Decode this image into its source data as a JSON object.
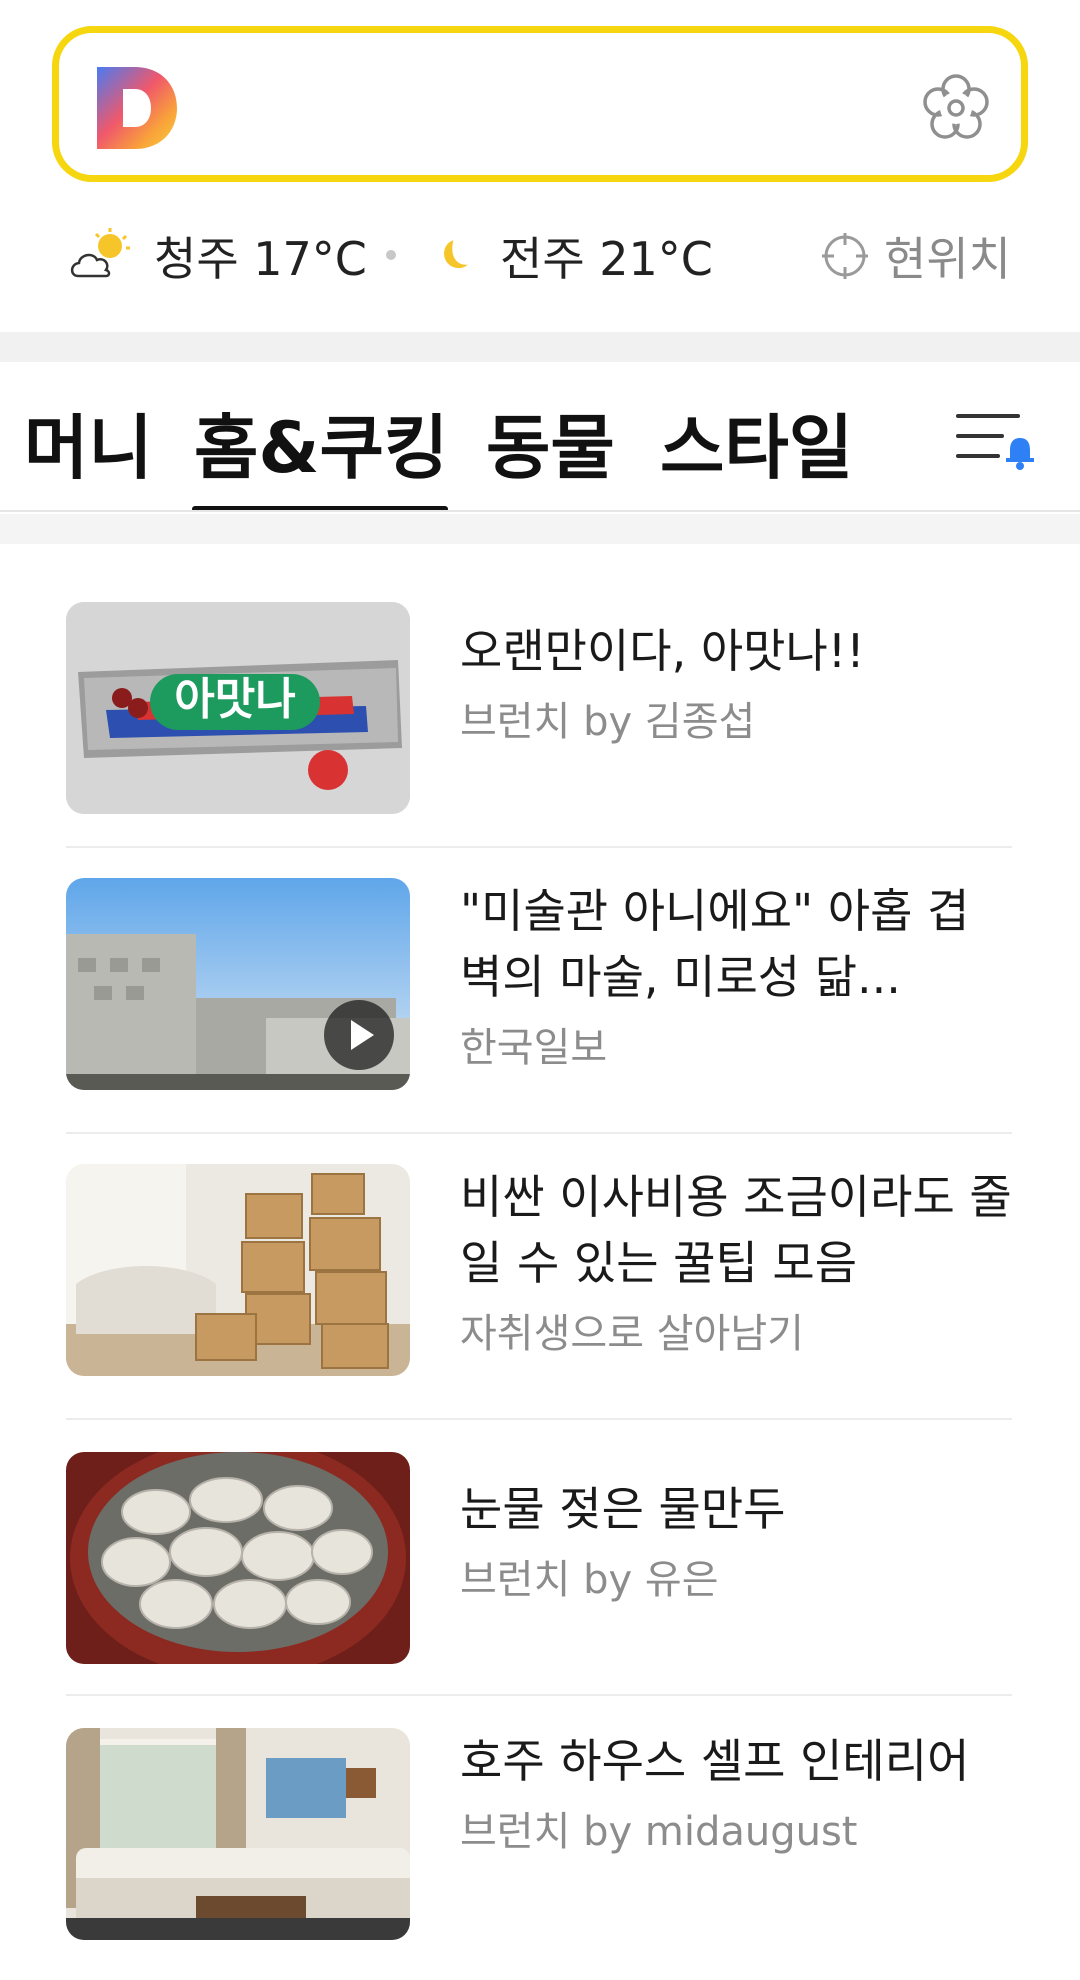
{
  "search": {
    "logo": "daum-logo",
    "right_icon": "flower-icon",
    "border_color": "#f5d60f"
  },
  "weather": {
    "items": [
      {
        "icon": "sun-cloud-icon",
        "label": "청주 17°C"
      },
      {
        "icon": "moon-icon",
        "label": "전주 21°C"
      }
    ],
    "location": {
      "icon": "crosshair-icon",
      "label": "현위치"
    }
  },
  "tabs": {
    "items": [
      {
        "label": "머니"
      },
      {
        "label": "홈&쿠킹",
        "active": true
      },
      {
        "label": "동물"
      },
      {
        "label": "스타일"
      },
      {
        "label": ""
      }
    ],
    "menu_icon": "menu-notification-icon"
  },
  "articles": [
    {
      "title": "오랜만이다, 아맛나!!",
      "source": "브런치 by 김종섭",
      "thumb": "ice-cream-wrapper"
    },
    {
      "title": "\"미술관 아니에요\" 아홉 겹 벽의 마술, 미로성 닮...",
      "source": "한국일보",
      "thumb": "building-video"
    },
    {
      "title": "비싼 이사비용 조금이라도 줄일 수 있는 꿀팁 모음",
      "source": "자취생으로 살아남기",
      "thumb": "moving-boxes"
    },
    {
      "title": "눈물 젖은 물만두",
      "source": "브런치 by 유은",
      "thumb": "dumplings"
    },
    {
      "title": "호주 하우스 셀프 인테리어",
      "source": "브런치 by midaugust",
      "thumb": "living-room"
    }
  ]
}
